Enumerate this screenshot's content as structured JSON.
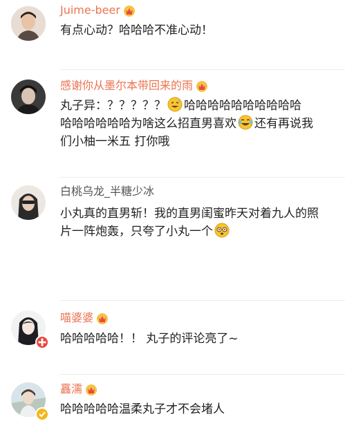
{
  "comments": [
    {
      "username": "Juime-beer",
      "text": "有点心动？哈哈哈不准心动！"
    },
    {
      "username": "感谢你从墨尔本带回来的雨",
      "line1_before": "丸子异：？？？？？",
      "line1_after": "哈哈哈哈哈哈哈哈哈哈",
      "line2_before": "哈哈哈哈哈哈为啥这么招直男喜欢",
      "line2_after": "还有再说我",
      "line3": "们小柚一米五 打你哦"
    },
    {
      "username": "白桃乌龙_半糖少冰",
      "line1": "小丸真的直男斩！我的直男闺蜜昨天对着九人的照",
      "line2": "片一阵炮轰，只夸了小丸一个"
    },
    {
      "username": "喵婆婆",
      "text": "哈哈哈哈哈！！ 丸子的评论亮了~"
    },
    {
      "username": "靐濡",
      "text": "哈哈哈哈哈温柔丸子才不会堵人"
    }
  ],
  "colors": {
    "username_vip": "#eb7350",
    "username_normal": "#555555",
    "text": "#222222",
    "divider": "#ececec"
  },
  "icons": [
    "crown-badge-icon",
    "grin-sweat-emoji",
    "laugh-cry-emoji",
    "dizzy-emoji",
    "red-flower-badge",
    "verified-badge"
  ]
}
